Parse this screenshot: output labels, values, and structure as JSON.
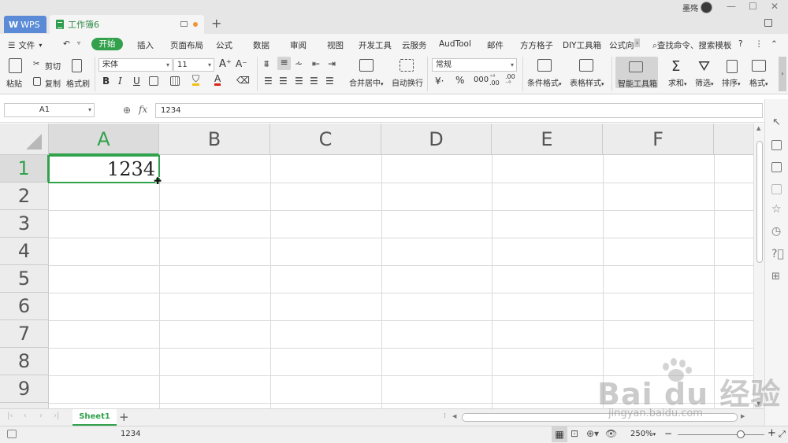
{
  "titlebar": {
    "wps_tab": "WPS",
    "doc_tab": "工作簿6",
    "user_name": "墨殇",
    "new_tab": "+"
  },
  "menu": {
    "file": "文件",
    "start": "开始",
    "items": [
      "插入",
      "页面布局",
      "公式",
      "数据",
      "审阅",
      "视图",
      "开发工具",
      "云服务",
      "AudTool",
      "邮件",
      "方方格子",
      "DIY工具箱",
      "公式向"
    ],
    "search": "查找命令、搜索模板"
  },
  "ribbon": {
    "paste": "粘贴",
    "cut": "剪切",
    "copy": "复制",
    "format_painter": "格式刷",
    "font_name": "宋体",
    "font_size": "11",
    "bold": "B",
    "italic": "I",
    "underline": "U",
    "merge_center": "合并居中",
    "wrap_text": "自动换行",
    "number_format": "常规",
    "conditional_format": "条件格式",
    "table_style": "表格样式",
    "smart_toolbox": "智能工具箱",
    "sum": "求和",
    "filter": "筛选",
    "sort": "排序",
    "format": "格式"
  },
  "formula_bar": {
    "name_box": "A1",
    "fx": "fx",
    "value": "1234"
  },
  "grid": {
    "columns": [
      "A",
      "B",
      "C",
      "D",
      "E",
      "F"
    ],
    "rows": [
      "1",
      "2",
      "3",
      "4",
      "5",
      "6",
      "7",
      "8",
      "9"
    ],
    "active_cell_value": "1234"
  },
  "sheets": {
    "tabs": [
      "Sheet1"
    ],
    "add": "+"
  },
  "status": {
    "cell_value": "1234",
    "zoom": "250%"
  },
  "watermark": {
    "main": "Bai du 经验",
    "sub": "jingyan.baidu.com"
  },
  "colors": {
    "accent": "#31a24c",
    "wps_blue": "#5b8bd6"
  }
}
